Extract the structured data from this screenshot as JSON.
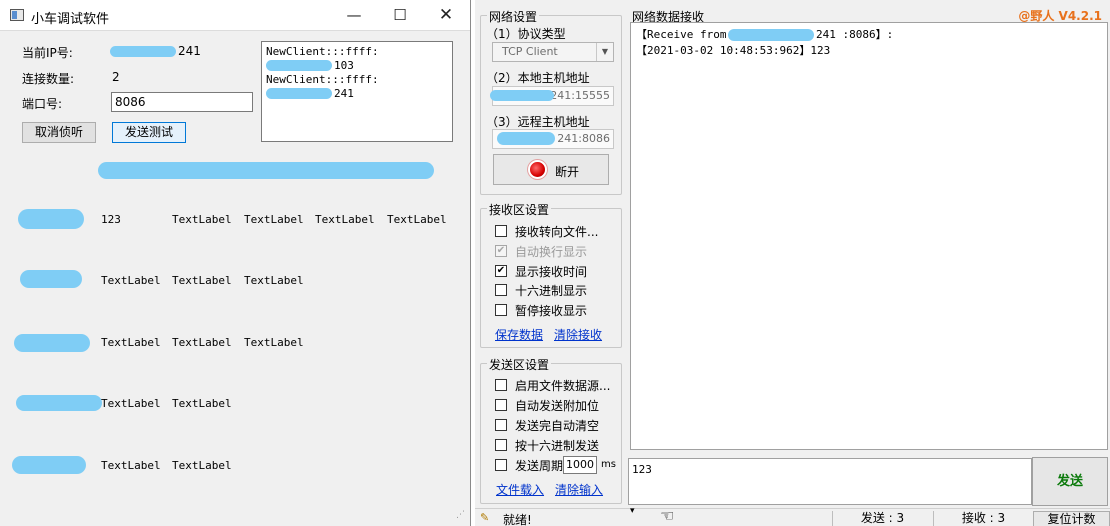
{
  "left_window": {
    "title": "小车调试软件",
    "controls": {
      "minimize": "—",
      "maximize": "☐",
      "close": "✕"
    },
    "ip_label": "当前IP号:",
    "ip_value_suffix": "241",
    "connection_count_label": "连接数量:",
    "connection_count_value": "2",
    "port_label": "端口号:",
    "port_value": "8086",
    "cancel_listen_button": "取消侦听",
    "send_test_button": "发送测试",
    "client_list": [
      {
        "line1": "NewClient:::ffff:",
        "line2": "103"
      },
      {
        "line1": "NewClient:::ffff:",
        "line2": "241"
      }
    ],
    "rows": [
      {
        "cells": [
          "123",
          "TextLabel",
          "TextLabel",
          "TextLabel",
          "TextLabel"
        ]
      },
      {
        "cells": [
          "TextLabel",
          "TextLabel",
          "TextLabel"
        ]
      },
      {
        "cells": [
          "TextLabel",
          "TextLabel",
          "TextLabel"
        ]
      },
      {
        "cells": [
          "TextLabel",
          "TextLabel"
        ]
      },
      {
        "cells": [
          "TextLabel",
          "TextLabel"
        ]
      }
    ]
  },
  "right_window": {
    "brand": "@野人 V4.2.1",
    "network_settings": {
      "title": "网络设置",
      "protocol_label": "（1）协议类型",
      "protocol_value": "TCP Client",
      "local_label": "（2）本地主机地址",
      "local_value": "241:15555",
      "remote_label": "（3）远程主机地址",
      "remote_value": "241:8086",
      "disconnect_button": "断开"
    },
    "receive_settings": {
      "title": "接收区设置",
      "options": [
        {
          "label": "接收转向文件...",
          "checked": false,
          "disabled": false
        },
        {
          "label": "自动换行显示",
          "checked": true,
          "disabled": true
        },
        {
          "label": "显示接收时间",
          "checked": true,
          "disabled": false
        },
        {
          "label": "十六进制显示",
          "checked": false,
          "disabled": false
        },
        {
          "label": "暂停接收显示",
          "checked": false,
          "disabled": false
        }
      ],
      "save_link": "保存数据",
      "clear_link": "清除接收"
    },
    "send_settings": {
      "title": "发送区设置",
      "options": [
        {
          "label": "启用文件数据源...",
          "checked": false
        },
        {
          "label": "自动发送附加位",
          "checked": false
        },
        {
          "label": "发送完自动清空",
          "checked": false
        },
        {
          "label": "按十六进制发送",
          "checked": false
        }
      ],
      "period_label": "发送周期",
      "period_value": "1000",
      "period_unit": "ms",
      "load_file_link": "文件载入",
      "clear_input_link": "清除输入"
    },
    "receive_area": {
      "title": "网络数据接收",
      "line1_prefix": "【Receive from",
      "line1_suffix": "241 :8086】:",
      "line2": "【2021-03-02 10:48:53:962】123"
    },
    "send_input_value": "123",
    "send_button": "发送",
    "status": {
      "ready": "就绪!",
      "sent": "发送 : 3",
      "received": "接收 : 3",
      "reset": "复位计数"
    }
  }
}
